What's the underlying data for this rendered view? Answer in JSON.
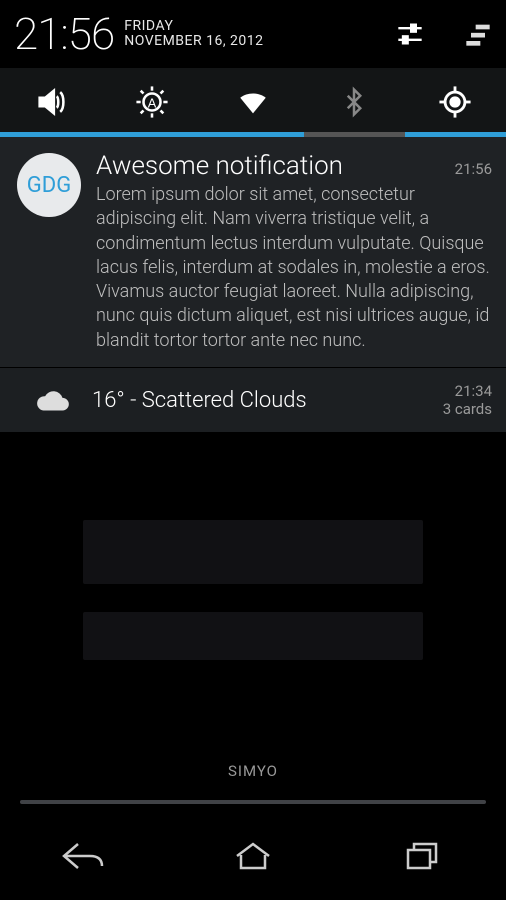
{
  "status": {
    "time": "21:56",
    "day": "FRIDAY",
    "date": "NOVEMBER 16, 2012"
  },
  "notifications": [
    {
      "avatar_text": "GDG",
      "title": "Awesome notification",
      "time": "21:56",
      "body": "Lorem ipsum dolor sit amet, consectetur adipiscing elit. Nam viverra tristique velit, a condimentum lectus interdum vulputate. Quisque lacus felis, interdum at sodales in, molestie a eros. Vivamus auctor feugiat laoreet. Nulla adipiscing, nunc quis dictum aliquet, est nisi ultrices augue, id blandit tortor tortor ante nec nunc."
    },
    {
      "title": "16° - Scattered Clouds",
      "time": "21:34",
      "sub": "3 cards"
    }
  ],
  "carrier": "SIMYO",
  "toggle_states": [
    "on",
    "on",
    "on",
    "off",
    "on"
  ]
}
